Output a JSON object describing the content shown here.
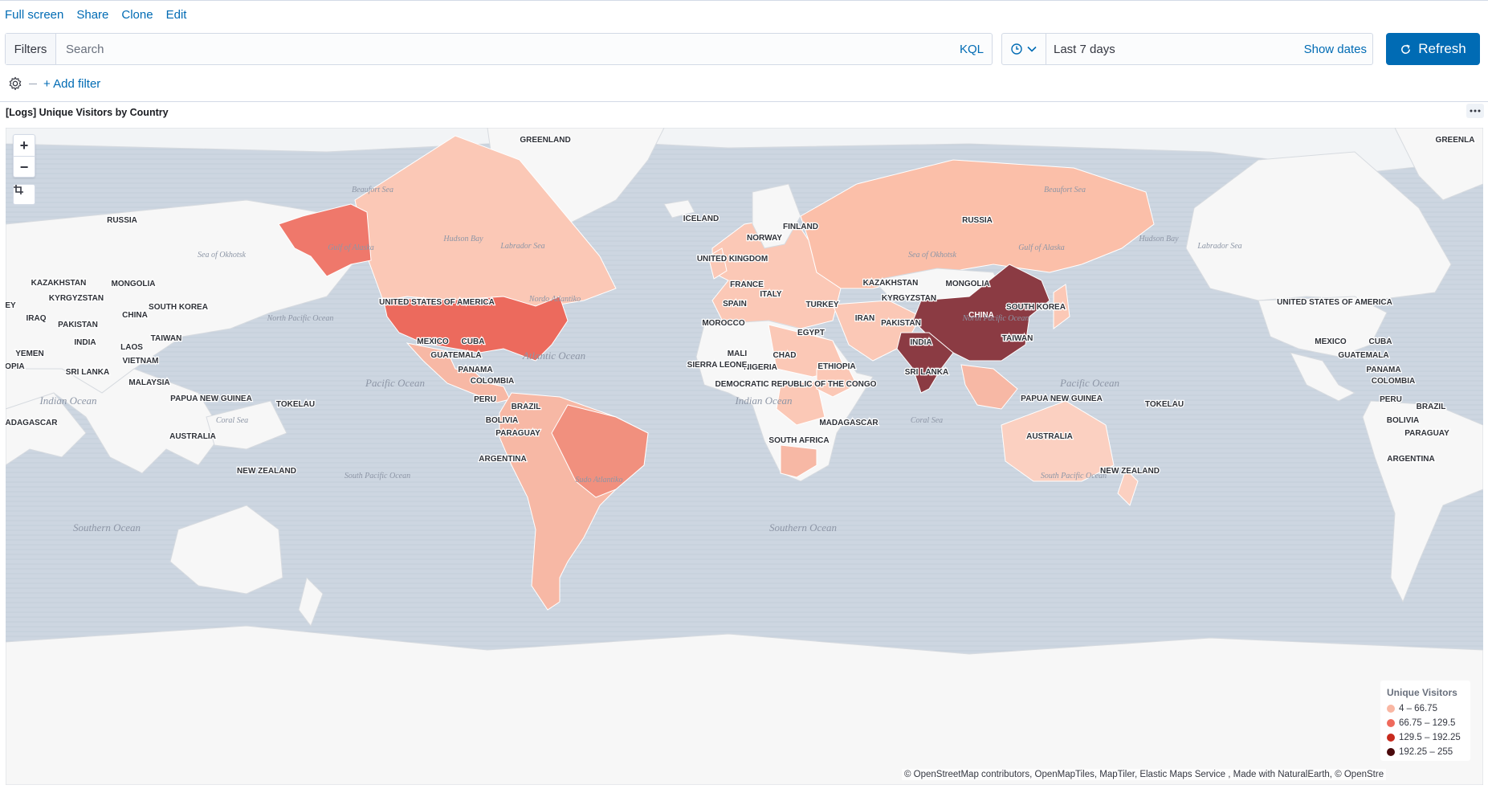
{
  "topnav": {
    "full_screen": "Full screen",
    "share": "Share",
    "clone": "Clone",
    "edit": "Edit"
  },
  "querybar": {
    "filters_label": "Filters",
    "search_placeholder": "Search",
    "search_value": "",
    "kql_label": "KQL",
    "date_range": "Last 7 days",
    "show_dates": "Show dates",
    "refresh": "Refresh"
  },
  "filterrow": {
    "add_filter": "+ Add filter"
  },
  "panel": {
    "title": "[Logs] Unique Visitors by Country",
    "legend": {
      "title": "Unique Visitors",
      "items": [
        {
          "label": "4 – 66.75",
          "color": "#f9b7a3"
        },
        {
          "label": "66.75 – 129.5",
          "color": "#ef6a5c"
        },
        {
          "label": "129.5 – 192.25",
          "color": "#c72b1e"
        },
        {
          "label": "192.25 – 255",
          "color": "#4b0a0c"
        }
      ]
    },
    "attribution": "© OpenStreetMap contributors, OpenMapTiles, MapTiler, Elastic Maps Service , Made with NaturalEarth, © OpenStre",
    "map_labels": {
      "greenland_left": "GREENLAND",
      "greenland_right": "GREENLA",
      "russia_left": "RUSSIA",
      "russia_mid": "RUSSIA",
      "iceland": "ICELAND",
      "finland": "FINLAND",
      "norway": "NORWAY",
      "uk": "UNITED KINGDOM",
      "france": "FRANCE",
      "italy": "ITALY",
      "spain": "SPAIN",
      "turkey": "TURKEY",
      "morocco": "MOROCCO",
      "egypt": "EGYPT",
      "mali": "MALI",
      "chad": "CHAD",
      "nigeria": "NIGERIA",
      "ethiopia": "ETHIOPIA",
      "sierra_leone": "SIERRA LEONE",
      "drc": "DEMOCRATIC REPUBLIC OF THE CONGO",
      "south_africa": "SOUTH AFRICA",
      "madagascar_mid": "MADAGASCAR",
      "madagascar_left": "ADAGASCAR",
      "yemen": "YEMEN",
      "ethiopia_left": "IOPIA",
      "iraq": "IRAQ",
      "iran": "IRAN",
      "pakistan": "PAKISTAN",
      "india": "INDIA",
      "kazakhstan": "KAZAKHSTAN",
      "mongolia": "MONGOLIA",
      "kyrgyzstan": "KYRGYZSTAN",
      "china": "CHINA",
      "south_korea": "SOUTH KOREA",
      "taiwan": "TAIWAN",
      "laos": "LAOS",
      "vietnam": "VIETNAM",
      "sri_lanka": "SRI LANKA",
      "malaysia": "MALAYSIA",
      "png": "PAPUA NEW GUINEA",
      "australia": "AUSTRALIA",
      "new_zealand": "NEW ZEALAND",
      "tokelau": "TOKELAU",
      "usa": "UNITED STATES OF AMERICA",
      "mexico": "MEXICO",
      "cuba": "CUBA",
      "guatemala": "GUATEMALA",
      "panama": "PANAMA",
      "colombia": "COLOMBIA",
      "peru": "PERU",
      "brazil": "BRAZIL",
      "bolivia": "BOLIVIA",
      "paraguay": "PARAGUAY",
      "argentina": "ARGENTINA",
      "ey": "EY",
      "ocean_north_atlantic": "Nordo Atlantiko",
      "ocean_atlantic": "Atlantic Ocean",
      "ocean_pacific": "Pacific Ocean",
      "ocean_north_pacific": "North Pacific Ocean",
      "ocean_south_pacific": "South Pacific Ocean",
      "ocean_indian": "Indian Ocean",
      "ocean_southern": "Southern Ocean",
      "ocean_sudo": "Sudo Atlantiko",
      "sea_okhotsk": "Sea of Okhotsk",
      "coral_sea": "Coral Sea",
      "hudson_bay": "Hudson Bay",
      "labrador_sea": "Labrador Sea",
      "beaufort_sea": "Beaufort Sea",
      "gulf_alaska": "Gulf of Alaska"
    }
  }
}
